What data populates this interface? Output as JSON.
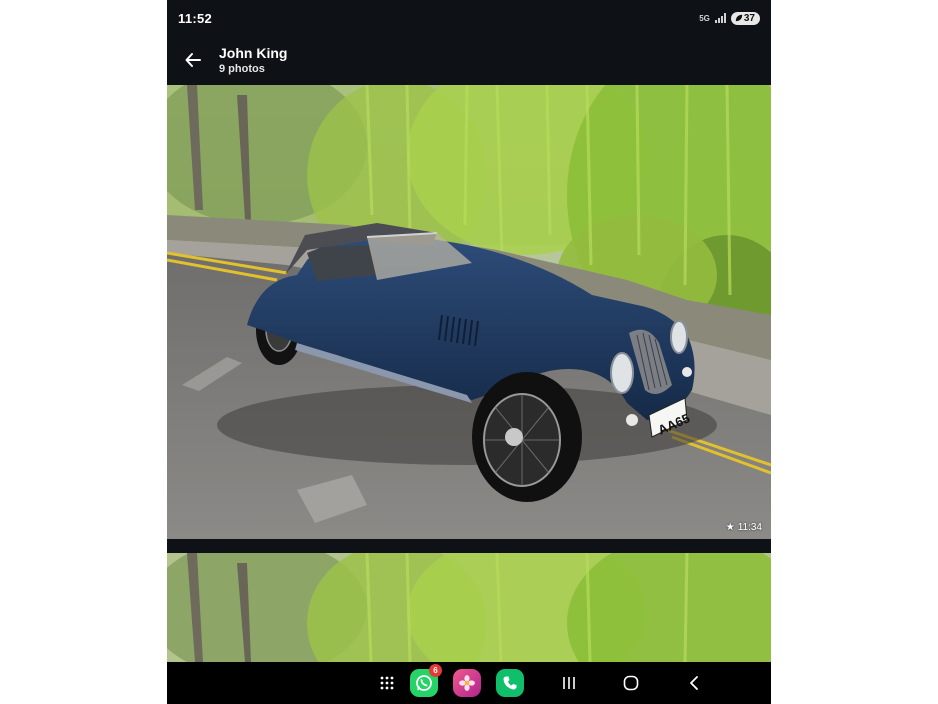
{
  "status_bar": {
    "time": "11:52",
    "sim_label": "5G",
    "battery_level": "37"
  },
  "header": {
    "contact_name": "John King",
    "photo_count": "9 photos"
  },
  "photos": [
    {
      "timestamp": "11:34",
      "starred": true,
      "description_icon": "car-photo"
    },
    {
      "partial": true,
      "description_icon": "tree-photo"
    }
  ],
  "plate_text": "AA65",
  "taskbar": {
    "whatsapp_badge": "6",
    "apps": [
      "app-drawer-icon",
      "whatsapp-icon",
      "gallery-icon",
      "phone-icon"
    ],
    "nav": [
      "recents-icon",
      "home-icon",
      "back-icon"
    ]
  },
  "colors": {
    "app_bg": "#0e1216",
    "car_body": "#1d3558",
    "whatsapp": "#25d366",
    "phone_app": "#0fbf6b",
    "gallery": "#d82f78"
  }
}
